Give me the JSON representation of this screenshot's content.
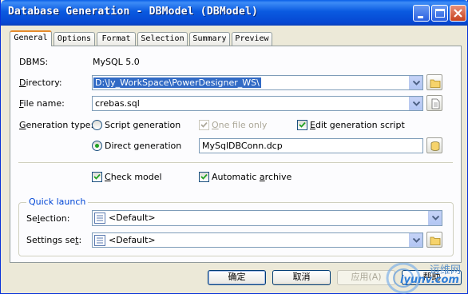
{
  "window": {
    "title": "Database Generation - DBModel (DBModel)"
  },
  "tabs": [
    {
      "label": "General",
      "active": true
    },
    {
      "label": "Options"
    },
    {
      "label": "Format"
    },
    {
      "label": "Selection"
    },
    {
      "label": "Summary"
    },
    {
      "label": "Preview"
    }
  ],
  "general": {
    "dbms_label": "DBMS:",
    "dbms_value": "MySQL 5.0",
    "directory_label": "Directory:",
    "directory_value": "D:\\Jy_WorkSpace\\PowerDesigner_WS\\",
    "filename_label": "File name:",
    "filename_value": "crebas.sql",
    "generation_type_label": "Generation type:",
    "script_generation": "Script generation",
    "one_file_only": "One file only",
    "edit_generation_script": "Edit generation script",
    "direct_generation": "Direct generation",
    "datasource_value": "MySqlDBConn.dcp",
    "check_model": "Check model",
    "automatic_archive": "Automatic archive"
  },
  "quick_launch": {
    "title": "Quick launch",
    "selection_label": "Selection:",
    "selection_value": "<Default>",
    "settings_label": "Settings set:",
    "settings_value": "<Default>"
  },
  "buttons": {
    "ok": "确定",
    "cancel": "取消",
    "apply": "应用(A)",
    "help": "帮助"
  },
  "watermark": {
    "line1": "运维网",
    "line2": "iyunv.com"
  },
  "colors": {
    "titlebar": "#0a5ae0",
    "selection": "#316ac5",
    "group_title": "#0046d5",
    "check": "#21a121"
  }
}
